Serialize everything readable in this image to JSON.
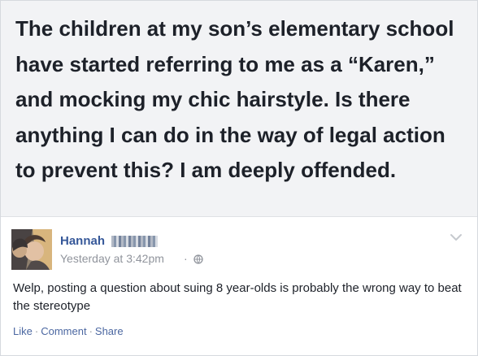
{
  "post": {
    "text": "The children at my son’s elementary school have started referring to me as a “Karen,” and mocking my chic hairstyle. Is there anything I can do in the way of legal action to prevent this? I am deeply offended."
  },
  "comment": {
    "name": "Hannah",
    "timestamp": "Yesterday at 3:42pm",
    "separator": "·",
    "text": "Welp, posting a question about suing 8 year-olds is probably the wrong way to beat the stereotype",
    "actions": {
      "like": "Like",
      "comment": "Comment",
      "share": "Share",
      "separator": "·"
    }
  },
  "icons": {
    "avatar": "profile-photo",
    "visibility": "globe-icon",
    "menu": "chevron-down-icon"
  },
  "colors": {
    "post_background": "#f2f3f5",
    "body_text": "#1d2129",
    "link_blue": "#365899",
    "muted_gray": "#90949c"
  }
}
